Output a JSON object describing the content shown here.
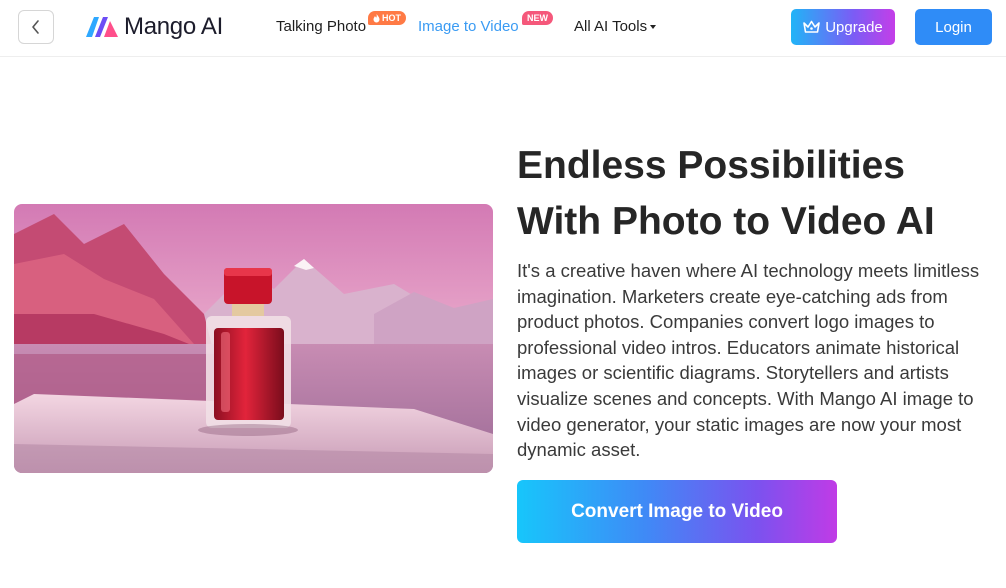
{
  "header": {
    "brand": "Mango AI",
    "nav": [
      {
        "label": "Talking Photo",
        "badge": "HOT"
      },
      {
        "label": "Image to Video",
        "badge": "NEW"
      },
      {
        "label": "All AI Tools"
      }
    ],
    "upgrade_label": "Upgrade",
    "login_label": "Login"
  },
  "hero": {
    "title_line1": "Endless Possibilities",
    "title_line2": "With Photo to Video AI",
    "description": "It's a creative haven where AI technology meets limitless imagination. Marketers create eye-catching ads from product photos. Companies convert logo images to professional video intros. Educators animate historical images or scientific diagrams. Storytellers and artists visualize scenes and concepts. With Mango AI image to video generator, your static images are now your most dynamic asset.",
    "cta_label": "Convert Image to Video"
  },
  "colors": {
    "accent_blue": "#2f8cf7",
    "nav_active": "#3a9bf3",
    "hot_badge": "#ff7a45",
    "new_badge": "#f5587b"
  },
  "icons": [
    "chevron-left-icon",
    "mango-logo",
    "flame-icon",
    "crown-icon",
    "caret-down-icon"
  ]
}
